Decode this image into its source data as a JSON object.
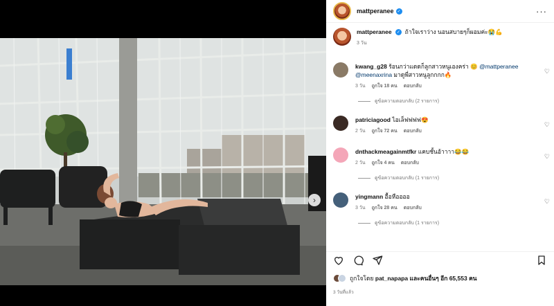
{
  "post": {
    "username": "mattperanee",
    "caption": "ถ้าใจเราว่าง นอนสบายๆก็ผอมค่ะ😭💪",
    "caption_time": "3 วัน",
    "carousel_count": 5,
    "carousel_active": 0,
    "next_icon": "chevron-right-icon"
  },
  "comments": [
    {
      "user": "kwang_g28",
      "text": "ร้อนกว่าแดดก็ลูกสาวหนูเองคร่า 😊",
      "mention1": "@mattperanee",
      "mention2": "@meenaxrina",
      "text2": "มาดูพี่สาวหนูลูกกกก🔥",
      "time": "3 วัน",
      "likes": "ถูกใจ 18 คน",
      "reply": "ตอบกลับ",
      "replies_label": "ดูข้อความตอบกลับ (2 รายการ)",
      "avatar_color": "#8a7a66"
    },
    {
      "user": "patriciagood",
      "text": "ไอเล็ฟฟฟฟ😍",
      "time": "2 วัน",
      "likes": "ถูกใจ 72 คน",
      "reply": "ตอบกลับ",
      "avatar_color": "#3a2a24"
    },
    {
      "user": "dnthackmeagainmtfkr",
      "text": "แคบชั้นอ้าาาา😂😂",
      "time": "2 วัน",
      "likes": "ถูกใจ 4 คน",
      "reply": "ตอบกลับ",
      "replies_label": "ดูข้อความตอบกลับ (1 รายการ)",
      "avatar_color": "#f4a6b8"
    },
    {
      "user": "yingmann",
      "text": "อื้อหืออออ",
      "time": "3 วัน",
      "likes": "ถูกใจ 28 คน",
      "reply": "ตอบกลับ",
      "replies_label": "ดูข้อความตอบกลับ (1 รายการ)",
      "avatar_color": "#45607a"
    }
  ],
  "footer": {
    "liked_by_prefix": "ถูกใจโดย",
    "liked_by_user": "pat_napapa",
    "liked_by_suffix": "และคนอื่นๆ อีก 65,553 คน",
    "posted": "3 วันที่แล้ว"
  },
  "colors": {
    "accent": "#1d8df0",
    "link": "#00376b",
    "muted": "#737373"
  }
}
